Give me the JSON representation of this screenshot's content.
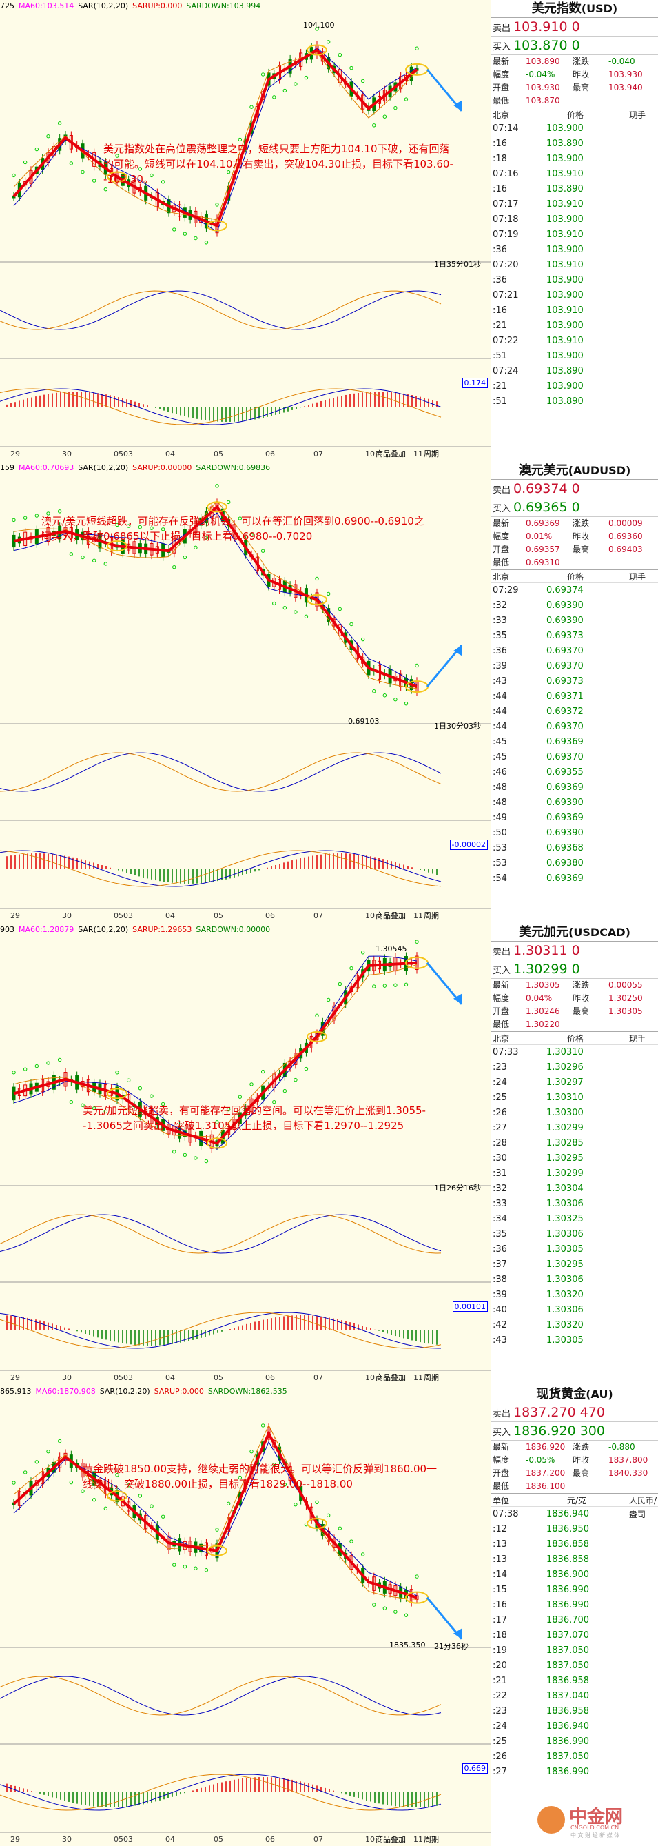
{
  "panels": [
    {
      "id": "usd",
      "topbar": [
        "725",
        "MA60:103.514",
        "SAR(10,2,20)",
        "SARUP:0.000",
        "SARDOWN:103.994"
      ],
      "title": "美元指数",
      "code": "(USD)",
      "sell_label": "卖出",
      "sell": "103.910 0",
      "buy_label": "买入",
      "buy": "103.870 0",
      "stats": [
        [
          "最新",
          "103.890",
          "涨跌",
          "-0.040"
        ],
        [
          "幅度",
          "-0.04%",
          "昨收",
          "103.930"
        ],
        [
          "开盘",
          "103.930",
          "最高",
          "103.940"
        ],
        [
          "最低",
          "103.870",
          "",
          ""
        ]
      ],
      "hdr": [
        "北京",
        "价格",
        "现手"
      ],
      "rows": [
        [
          "07:14",
          "103.900"
        ],
        [
          ":16",
          "103.890"
        ],
        [
          ":18",
          "103.900"
        ],
        [
          "07:16",
          "103.910"
        ],
        [
          ":16",
          "103.890"
        ],
        [
          "07:17",
          "103.910"
        ],
        [
          "07:18",
          "103.900"
        ],
        [
          "07:19",
          "103.910"
        ],
        [
          ":36",
          "103.900"
        ],
        [
          "07:20",
          "103.910"
        ],
        [
          ":36",
          "103.900"
        ],
        [
          "07:21",
          "103.900"
        ],
        [
          ":16",
          "103.910"
        ],
        [
          ":21",
          "103.900"
        ],
        [
          "07:22",
          "103.910"
        ],
        [
          ":51",
          "103.900"
        ],
        [
          "07:24",
          "103.890"
        ],
        [
          ":21",
          "103.900"
        ],
        [
          ":51",
          "103.890"
        ]
      ],
      "note": "美元指数处在高位震荡整理之中，短线只要上方阻力104.10下破，还有回落的可能。短线可以在104.10左右卖出，突破104.30止损，目标下看103.60--103.30。",
      "time_label": "1日35分01秒",
      "peak_label": "104.100",
      "vbox": "0.174",
      "xaxis": [
        "29",
        "30",
        "0503",
        "04",
        "05",
        "06",
        "07",
        "10",
        "11"
      ],
      "buttons": [
        "商品叠加",
        "周期"
      ]
    },
    {
      "id": "aud",
      "topbar": [
        "159",
        "MA60:0.70693",
        "SAR(10,2,20)",
        "SARUP:0.00000",
        "SARDOWN:0.69836"
      ],
      "title": "澳元美元",
      "code": "(AUDUSD)",
      "sell_label": "卖出",
      "sell": "0.69374 0",
      "buy_label": "买入",
      "buy": "0.69365 0",
      "stats": [
        [
          "最新",
          "0.69369",
          "涨跌",
          "0.00009"
        ],
        [
          "幅度",
          "0.01%",
          "昨收",
          "0.69360"
        ],
        [
          "开盘",
          "0.69357",
          "最高",
          "0.69403"
        ],
        [
          "最低",
          "0.69310",
          "",
          ""
        ]
      ],
      "hdr": [
        "北京",
        "价格",
        "现手"
      ],
      "rows": [
        [
          "07:29",
          "0.69374"
        ],
        [
          ":32",
          "0.69390"
        ],
        [
          ":33",
          "0.69390"
        ],
        [
          ":35",
          "0.69373"
        ],
        [
          ":36",
          "0.69370"
        ],
        [
          ":39",
          "0.69370"
        ],
        [
          ":43",
          "0.69373"
        ],
        [
          ":44",
          "0.69371"
        ],
        [
          ":44",
          "0.69372"
        ],
        [
          ":44",
          "0.69370"
        ],
        [
          ":45",
          "0.69369"
        ],
        [
          ":45",
          "0.69370"
        ],
        [
          ":46",
          "0.69355"
        ],
        [
          ":48",
          "0.69369"
        ],
        [
          ":48",
          "0.69390"
        ],
        [
          ":49",
          "0.69369"
        ],
        [
          ":50",
          "0.69390"
        ],
        [
          ":53",
          "0.69368"
        ],
        [
          ":53",
          "0.69380"
        ],
        [
          ":54",
          "0.69369"
        ]
      ],
      "note": "澳元/美元短线超跌，可能存在反弹的机会。可以在等汇价回落到0.6900--0.6910之间买入，跌破0.6865以下止损，目标上看0.6980--0.7020",
      "time_label": "1日30分03秒",
      "low_label": "0.69103",
      "vbox": "-0.00002",
      "xaxis": [
        "29",
        "30",
        "0503",
        "04",
        "05",
        "06",
        "07",
        "10",
        "11"
      ],
      "buttons": [
        "商品叠加",
        "周期"
      ]
    },
    {
      "id": "cad",
      "topbar": [
        "903",
        "MA60:1.28879",
        "SAR(10,2,20)",
        "SARUP:1.29653",
        "SARDOWN:0.00000"
      ],
      "title": "美元加元",
      "code": "(USDCAD)",
      "sell_label": "卖出",
      "sell": "1.30311 0",
      "buy_label": "买入",
      "buy": "1.30299 0",
      "stats": [
        [
          "最新",
          "1.30305",
          "涨跌",
          "0.00055"
        ],
        [
          "幅度",
          "0.04%",
          "昨收",
          "1.30250"
        ],
        [
          "开盘",
          "1.30246",
          "最高",
          "1.30305"
        ],
        [
          "最低",
          "1.30220",
          "",
          ""
        ]
      ],
      "hdr": [
        "北京",
        "价格",
        "现手"
      ],
      "rows": [
        [
          "07:33",
          "1.30310"
        ],
        [
          ":23",
          "1.30296"
        ],
        [
          ":24",
          "1.30297"
        ],
        [
          ":25",
          "1.30310"
        ],
        [
          ":26",
          "1.30300"
        ],
        [
          ":27",
          "1.30299"
        ],
        [
          ":28",
          "1.30285"
        ],
        [
          ":30",
          "1.30295"
        ],
        [
          ":31",
          "1.30299"
        ],
        [
          ":32",
          "1.30304"
        ],
        [
          ":33",
          "1.30306"
        ],
        [
          ":34",
          "1.30325"
        ],
        [
          ":35",
          "1.30306"
        ],
        [
          ":36",
          "1.30305"
        ],
        [
          ":37",
          "1.30295"
        ],
        [
          ":38",
          "1.30306"
        ],
        [
          ":39",
          "1.30320"
        ],
        [
          ":40",
          "1.30306"
        ],
        [
          ":42",
          "1.30320"
        ],
        [
          ":43",
          "1.30305"
        ]
      ],
      "note": "美元/加元短线超卖，有可能存在回落的空间。可以在等汇价上涨到1.3055--1.3065之间卖出，突破1.3105以上止损，目标下看1.2970--1.2925",
      "time_label": "1日26分16秒",
      "peak_label": "1.30545",
      "vbox": "0.00101",
      "xaxis": [
        "29",
        "30",
        "0503",
        "04",
        "05",
        "06",
        "07",
        "10",
        "11"
      ],
      "buttons": [
        "商品叠加",
        "周期"
      ]
    },
    {
      "id": "gold",
      "topbar": [
        "865.913",
        "MA60:1870.908",
        "SAR(10,2,20)",
        "SARUP:0.000",
        "SARDOWN:1862.535"
      ],
      "title": "现货黄金",
      "code": "(AU)",
      "sell_label": "卖出",
      "sell": "1837.270 470",
      "buy_label": "买入",
      "buy": "1836.920 300",
      "stats": [
        [
          "最新",
          "1836.920",
          "涨跌",
          "-0.880"
        ],
        [
          "幅度",
          "-0.05%",
          "昨收",
          "1837.800"
        ],
        [
          "开盘",
          "1837.200",
          "最高",
          "1840.330"
        ],
        [
          "最低",
          "1836.100",
          "",
          ""
        ]
      ],
      "hdr": [
        "单位",
        "元/克",
        "人民币/盎司"
      ],
      "rows": [
        [
          "07:38",
          "1836.940"
        ],
        [
          ":12",
          "1836.950"
        ],
        [
          ":13",
          "1836.858"
        ],
        [
          ":13",
          "1836.858"
        ],
        [
          ":14",
          "1836.900"
        ],
        [
          ":15",
          "1836.990"
        ],
        [
          ":16",
          "1836.990"
        ],
        [
          ":17",
          "1836.700"
        ],
        [
          ":18",
          "1837.070"
        ],
        [
          ":19",
          "1837.050"
        ],
        [
          ":20",
          "1837.050"
        ],
        [
          ":21",
          "1836.958"
        ],
        [
          ":22",
          "1837.040"
        ],
        [
          ":23",
          "1836.958"
        ],
        [
          ":24",
          "1836.940"
        ],
        [
          ":25",
          "1836.990"
        ],
        [
          ":26",
          "1837.050"
        ],
        [
          ":27",
          "1836.990"
        ]
      ],
      "note": "黄金跌破1850.00支持，继续走弱的可能很大。可以等汇价反弹到1860.00一线卖出，突破1880.00止损，目标下看1829.00--1818.00",
      "time_label": "21分36秒",
      "low_label": "1835.350",
      "vbox": "0.669",
      "xaxis": [
        "29",
        "30",
        "0503",
        "04",
        "05",
        "06",
        "07",
        "10",
        "11"
      ],
      "buttons": [
        "商品叠加",
        "周期"
      ]
    }
  ],
  "logo": {
    "name": "中金网",
    "sub": "CNGOLD.COM.CN",
    "tag": "中 文 财 经 新 媒 体"
  },
  "colors": {
    "candle_up": "#e00000",
    "candle_down": "#008000",
    "trend": "#e8000b",
    "arrow": "#1e90ff",
    "highlight": "#f5c518",
    "sar": "#00cc00"
  },
  "chart_data": [
    {
      "type": "line",
      "title": "美元指数(USD)",
      "x": [
        "29",
        "30",
        "0503",
        "04",
        "05",
        "06",
        "07",
        "10",
        "11"
      ],
      "series": [
        {
          "values": [
            102.6,
            103.2,
            102.8,
            102.5,
            102.3,
            103.8,
            104.1,
            103.5,
            103.9
          ]
        }
      ],
      "ylim": [
        102.0,
        104.4
      ]
    },
    {
      "type": "line",
      "title": "澳元美元(AUDUSD)",
      "x": [
        "29",
        "30",
        "0503",
        "04",
        "05",
        "06",
        "07",
        "10",
        "11"
      ],
      "series": [
        {
          "values": [
            0.706,
            0.707,
            0.7055,
            0.705,
            0.7095,
            0.702,
            0.7,
            0.693,
            0.6911
          ]
        }
      ],
      "ylim": [
        0.688,
        0.712
      ]
    },
    {
      "type": "line",
      "title": "美元加元(USDCAD)",
      "x": [
        "29",
        "30",
        "0503",
        "04",
        "05",
        "06",
        "07",
        "10",
        "11"
      ],
      "series": [
        {
          "values": [
            1.287,
            1.289,
            1.287,
            1.282,
            1.28,
            1.288,
            1.295,
            1.305,
            1.3054
          ]
        }
      ],
      "ylim": [
        1.275,
        1.308
      ]
    },
    {
      "type": "line",
      "title": "现货黄金(AU)",
      "x": [
        "29",
        "30",
        "0503",
        "04",
        "05",
        "06",
        "07",
        "10",
        "11"
      ],
      "series": [
        {
          "values": [
            1860,
            1872,
            1862,
            1850,
            1848,
            1878,
            1855,
            1840,
            1836
          ]
        }
      ],
      "ylim": [
        1825,
        1885
      ]
    }
  ]
}
